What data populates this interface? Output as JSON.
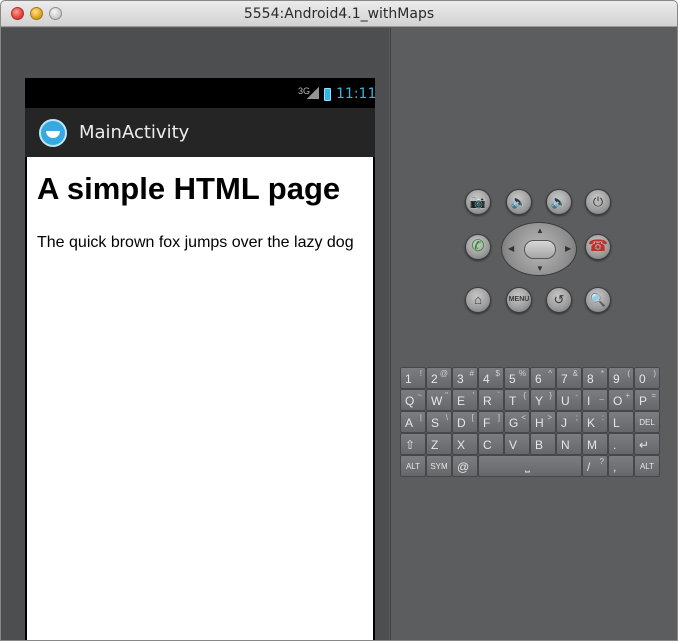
{
  "window": {
    "title": "5554:Android4.1_withMaps"
  },
  "statusbar": {
    "network": "3G",
    "time": "11:11"
  },
  "app": {
    "title": "MainActivity",
    "icon": "app-launcher-icon"
  },
  "webpage": {
    "heading": "A simple HTML page",
    "paragraph": "The quick brown fox jumps over the lazy dog"
  },
  "controls": {
    "camera": "📷",
    "vol_down": "🔉",
    "vol_up": "🔊",
    "power": "⏻",
    "call": "✆",
    "end": "☎",
    "home": "⌂",
    "menu": "MENU",
    "back": "↺",
    "search": "🔍"
  },
  "keyboard": {
    "row1": [
      {
        "main": "1",
        "sub": "!"
      },
      {
        "main": "2",
        "sub": "@"
      },
      {
        "main": "3",
        "sub": "#"
      },
      {
        "main": "4",
        "sub": "$"
      },
      {
        "main": "5",
        "sub": "%"
      },
      {
        "main": "6",
        "sub": "^"
      },
      {
        "main": "7",
        "sub": "&"
      },
      {
        "main": "8",
        "sub": "*"
      },
      {
        "main": "9",
        "sub": "("
      },
      {
        "main": "0",
        "sub": ")"
      }
    ],
    "row2": [
      {
        "main": "Q",
        "sub": "~"
      },
      {
        "main": "W",
        "sub": "\""
      },
      {
        "main": "E",
        "sub": "'"
      },
      {
        "main": "R",
        "sub": "`"
      },
      {
        "main": "T",
        "sub": "{"
      },
      {
        "main": "Y",
        "sub": "}"
      },
      {
        "main": "U",
        "sub": "-"
      },
      {
        "main": "I",
        "sub": "_"
      },
      {
        "main": "O",
        "sub": "+"
      },
      {
        "main": "P",
        "sub": "="
      }
    ],
    "row3": [
      {
        "main": "A",
        "sub": "|"
      },
      {
        "main": "S",
        "sub": "\\"
      },
      {
        "main": "D",
        "sub": "["
      },
      {
        "main": "F",
        "sub": "]"
      },
      {
        "main": "G",
        "sub": "<"
      },
      {
        "main": "H",
        "sub": ">"
      },
      {
        "main": "J",
        "sub": ";"
      },
      {
        "main": "K",
        "sub": ":"
      },
      {
        "main": "L",
        "sub": ""
      },
      {
        "main": "DEL",
        "sub": ""
      }
    ],
    "row4": [
      {
        "main": "⇧",
        "sub": ""
      },
      {
        "main": "Z",
        "sub": ""
      },
      {
        "main": "X",
        "sub": ""
      },
      {
        "main": "C",
        "sub": ""
      },
      {
        "main": "V",
        "sub": ""
      },
      {
        "main": "B",
        "sub": ""
      },
      {
        "main": "N",
        "sub": ""
      },
      {
        "main": "M",
        "sub": ""
      },
      {
        "main": ".",
        "sub": ""
      },
      {
        "main": "↵",
        "sub": ""
      }
    ],
    "row5": {
      "alt_left": "ALT",
      "sym": "SYM",
      "at": "@",
      "space": "⎵",
      "slash": "/",
      "slash_sub": "?",
      "comma": ",",
      "alt_right": "ALT"
    }
  }
}
